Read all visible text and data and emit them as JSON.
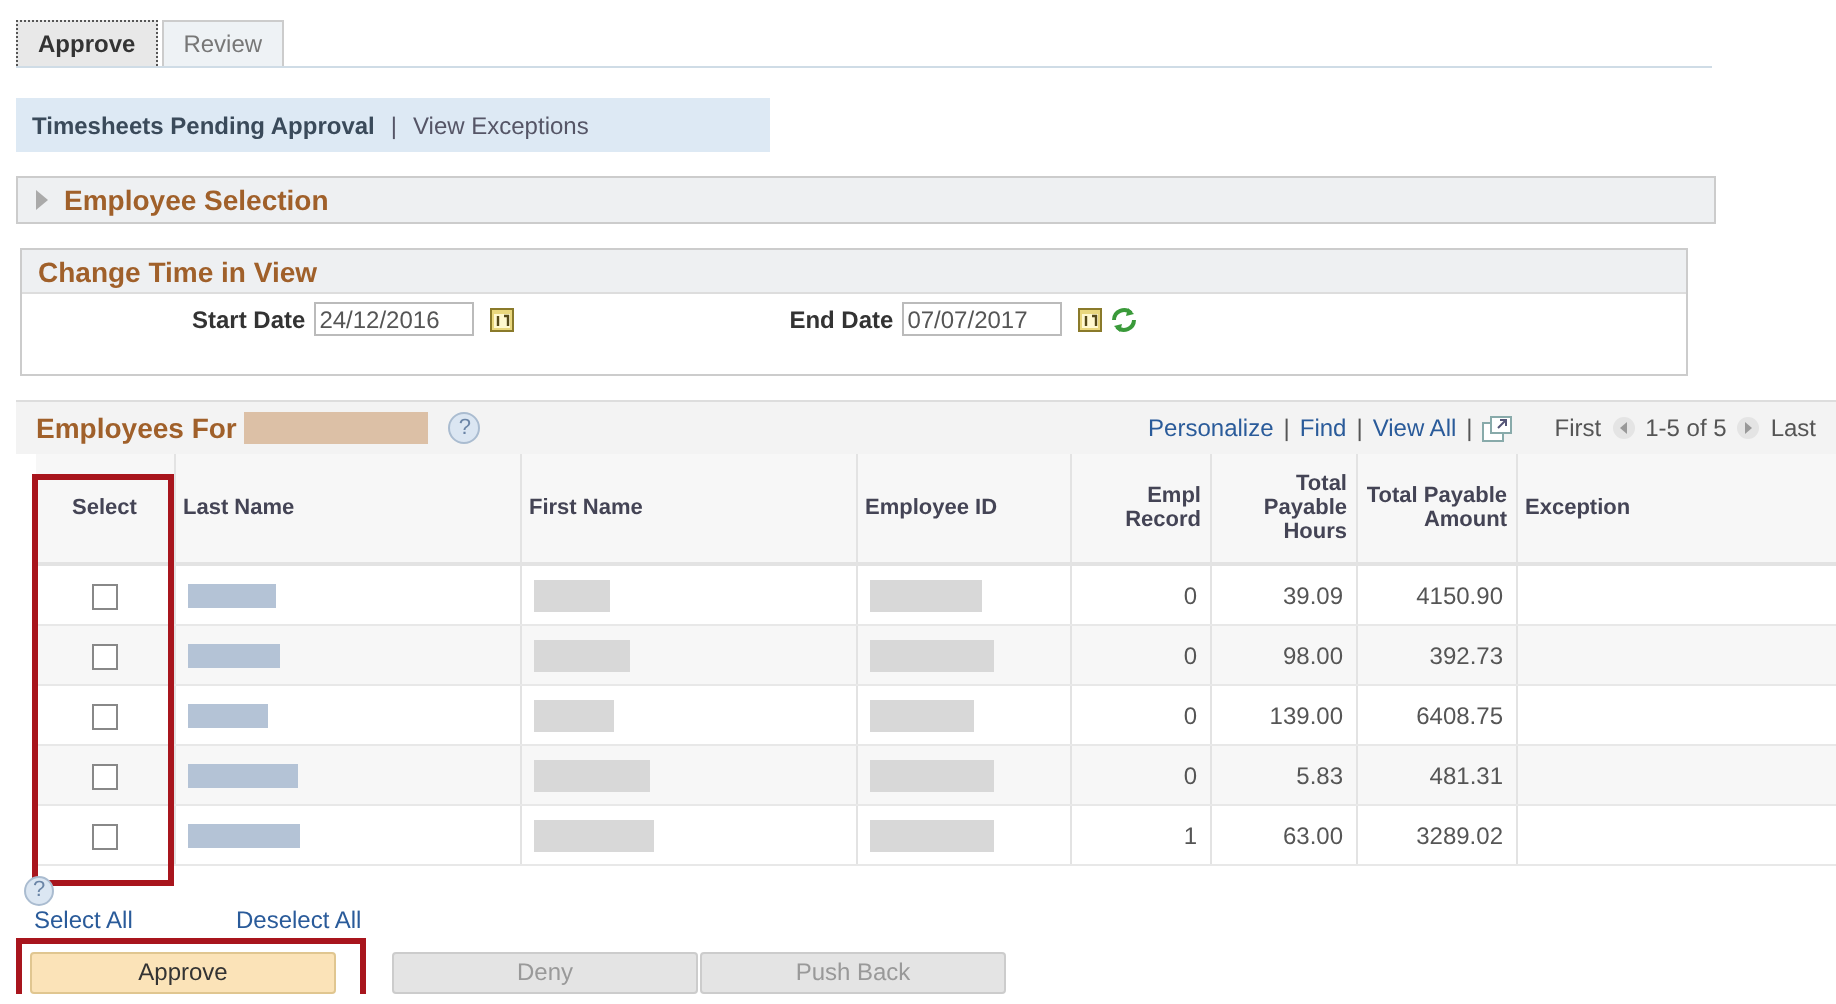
{
  "tabs": [
    {
      "label": "Approve",
      "selected": true
    },
    {
      "label": "Review",
      "selected": false
    }
  ],
  "nav_links": [
    {
      "label": "Timesheets Pending Approval",
      "selected": true
    },
    {
      "label": "View Exceptions",
      "selected": false
    }
  ],
  "nav_separator": "|",
  "employee_selection": {
    "title": "Employee Selection",
    "expanded": false
  },
  "change_time": {
    "title": "Change Time in View",
    "start_label": "Start Date",
    "start_value": "24/12/2016",
    "end_label": "End Date",
    "end_value": "07/07/2017"
  },
  "employees": {
    "title": "Employees For",
    "help": "?",
    "toolbar": {
      "links": [
        "Personalize",
        "Find",
        "View All"
      ],
      "separator": "|",
      "first": "First",
      "range": "1-5 of 5",
      "last": "Last"
    },
    "columns": [
      {
        "label": "Select",
        "highlight": true
      },
      {
        "label": "Last Name",
        "highlight": false
      },
      {
        "label": "First Name",
        "highlight": false
      },
      {
        "label": "Employee ID",
        "highlight": false
      },
      {
        "label": "Empl Record",
        "highlight": false
      },
      {
        "label": "Total Payable Hours",
        "highlight": false
      },
      {
        "label": "Total Payable Amount",
        "highlight": false
      },
      {
        "label": "Exception",
        "highlight": false
      }
    ],
    "rows": [
      {
        "checked": false,
        "empl_record": "0",
        "hours": "39.09",
        "amount": "4150.90"
      },
      {
        "checked": false,
        "empl_record": "0",
        "hours": "98.00",
        "amount": "392.73"
      },
      {
        "checked": false,
        "empl_record": "0",
        "hours": "139.00",
        "amount": "6408.75"
      },
      {
        "checked": false,
        "empl_record": "0",
        "hours": "5.83",
        "amount": "481.31"
      },
      {
        "checked": false,
        "empl_record": "1",
        "hours": "63.00",
        "amount": "3289.02"
      }
    ]
  },
  "help": "?",
  "select_all": "Select All",
  "deselect_all": "Deselect All",
  "buttons": [
    {
      "label": "Approve",
      "disabled": false,
      "highlight": true
    },
    {
      "label": "Deny",
      "disabled": true,
      "highlight": false
    },
    {
      "label": "Push Back",
      "disabled": true,
      "highlight": false
    }
  ]
}
